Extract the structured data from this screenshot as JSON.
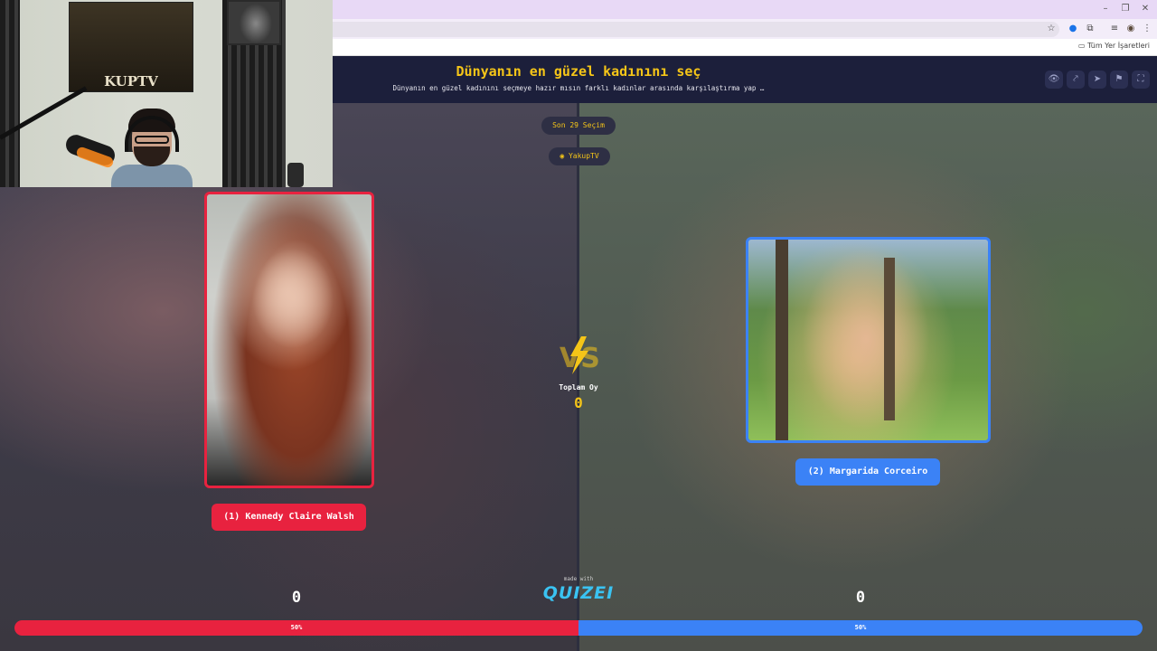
{
  "browser": {
    "bookmarks_label": "Tüm Yer İşaretleri",
    "toolbar_icons": [
      "star-icon",
      "extension-icon",
      "puzzle-icon",
      "menu-list-icon",
      "profile-icon",
      "more-icon"
    ],
    "window_controls": [
      "–",
      "❐",
      "✕"
    ]
  },
  "header": {
    "title": "Dünyanın en güzel kadınını seç",
    "subtitle": "Dünyanın en güzel kadınını seçmeye hazır mısın farklı kadınlar arasında karşılaştırma yap …",
    "actions": [
      "eye-icon",
      "share-icon",
      "send-icon",
      "flag-icon",
      "fullscreen-icon"
    ]
  },
  "round_pill": "Son 29 Seçim",
  "creator": {
    "name": "YakupTV"
  },
  "vs": {
    "total_label": "Toplam Oy",
    "total_value": "0"
  },
  "left": {
    "name": "(1) Kennedy Claire Walsh",
    "score": "0",
    "percent_label": "50%",
    "percent": 50,
    "color": "#e8223f"
  },
  "right": {
    "name": "(2) Margarida Corceiro",
    "score": "0",
    "percent_label": "50%",
    "percent": 50,
    "color": "#3b82f6"
  },
  "footer": {
    "made_with": "made with",
    "logo": "QUIZEI"
  },
  "webcam": {
    "poster_text": "KUPTV"
  }
}
